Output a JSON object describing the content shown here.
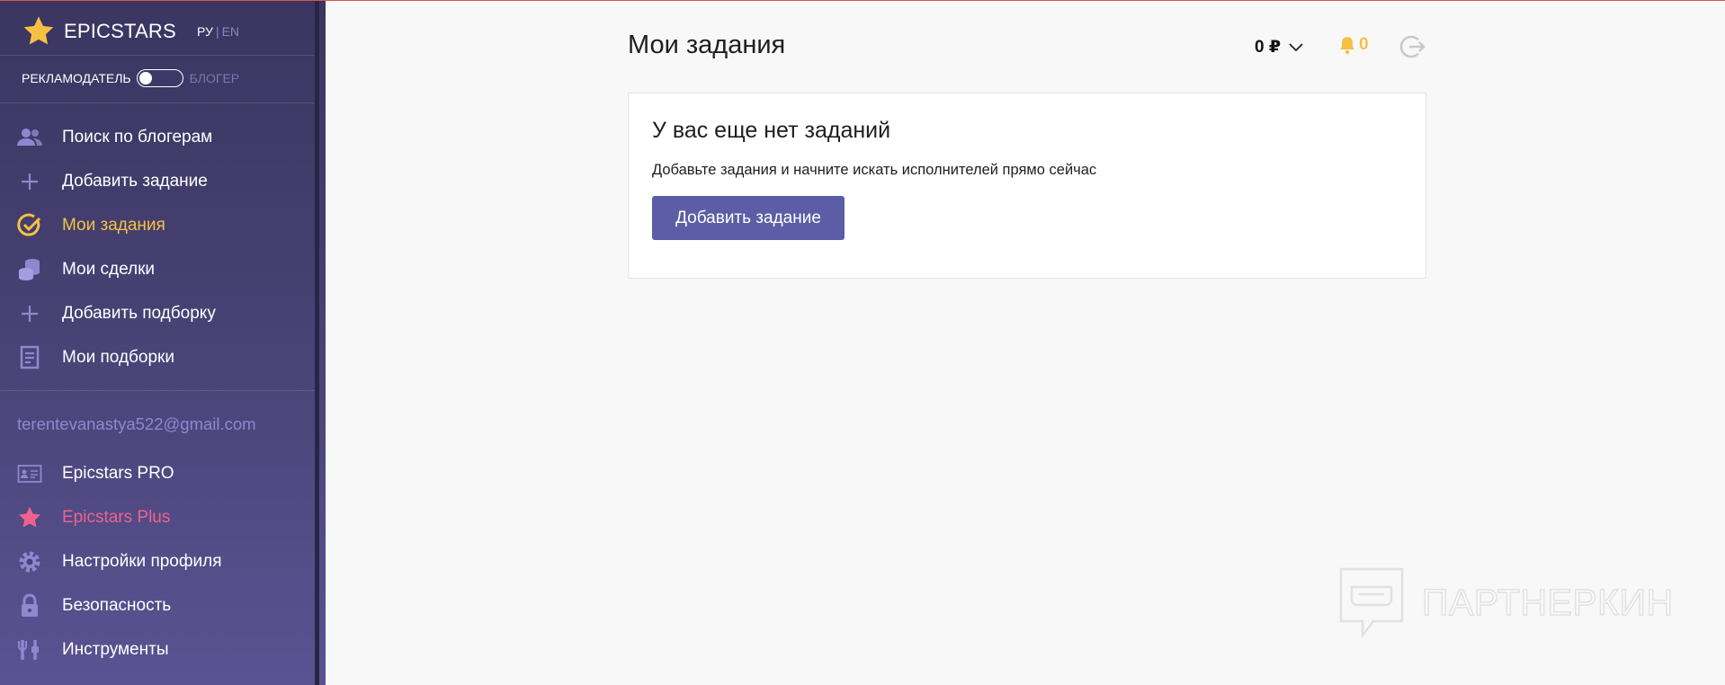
{
  "brand": {
    "name": "EPICSTARS"
  },
  "lang": {
    "ru": "РУ",
    "sep": "|",
    "en": "EN"
  },
  "role": {
    "advertiser": "РЕКЛАМОДАТЕЛЬ",
    "blogger": "БЛОГЕР"
  },
  "nav_main": [
    {
      "label": "Поиск по блогерам",
      "icon": "users-icon"
    },
    {
      "label": "Добавить задание",
      "icon": "plus-icon"
    },
    {
      "label": "Мои задания",
      "icon": "check-circle-icon",
      "active": true
    },
    {
      "label": "Мои сделки",
      "icon": "coins-icon"
    },
    {
      "label": "Добавить подборку",
      "icon": "plus-icon"
    },
    {
      "label": "Мои подборки",
      "icon": "list-doc-icon"
    }
  ],
  "email": "terentevanastya522@gmail.com",
  "nav_account": [
    {
      "label": "Epicstars PRO",
      "icon": "id-card-icon"
    },
    {
      "label": "Epicstars Plus",
      "icon": "star-icon"
    },
    {
      "label": "Настройки профиля",
      "icon": "gear-icon"
    },
    {
      "label": "Безопасность",
      "icon": "lock-icon"
    },
    {
      "label": "Инструменты",
      "icon": "tools-icon"
    }
  ],
  "header": {
    "title": "Мои задания",
    "balance": "0 ₽",
    "notifications": "0"
  },
  "empty_state": {
    "heading": "У вас еще нет заданий",
    "text": "Добавьте задания и начните искать исполнителей прямо сейчас",
    "button": "Добавить задание"
  },
  "watermark": "ПАРТНЕРКИН",
  "colors": {
    "accent": "#5b5ea6",
    "active": "#f5c143",
    "plus": "#f0628d",
    "sidebar": "#3b3561"
  }
}
